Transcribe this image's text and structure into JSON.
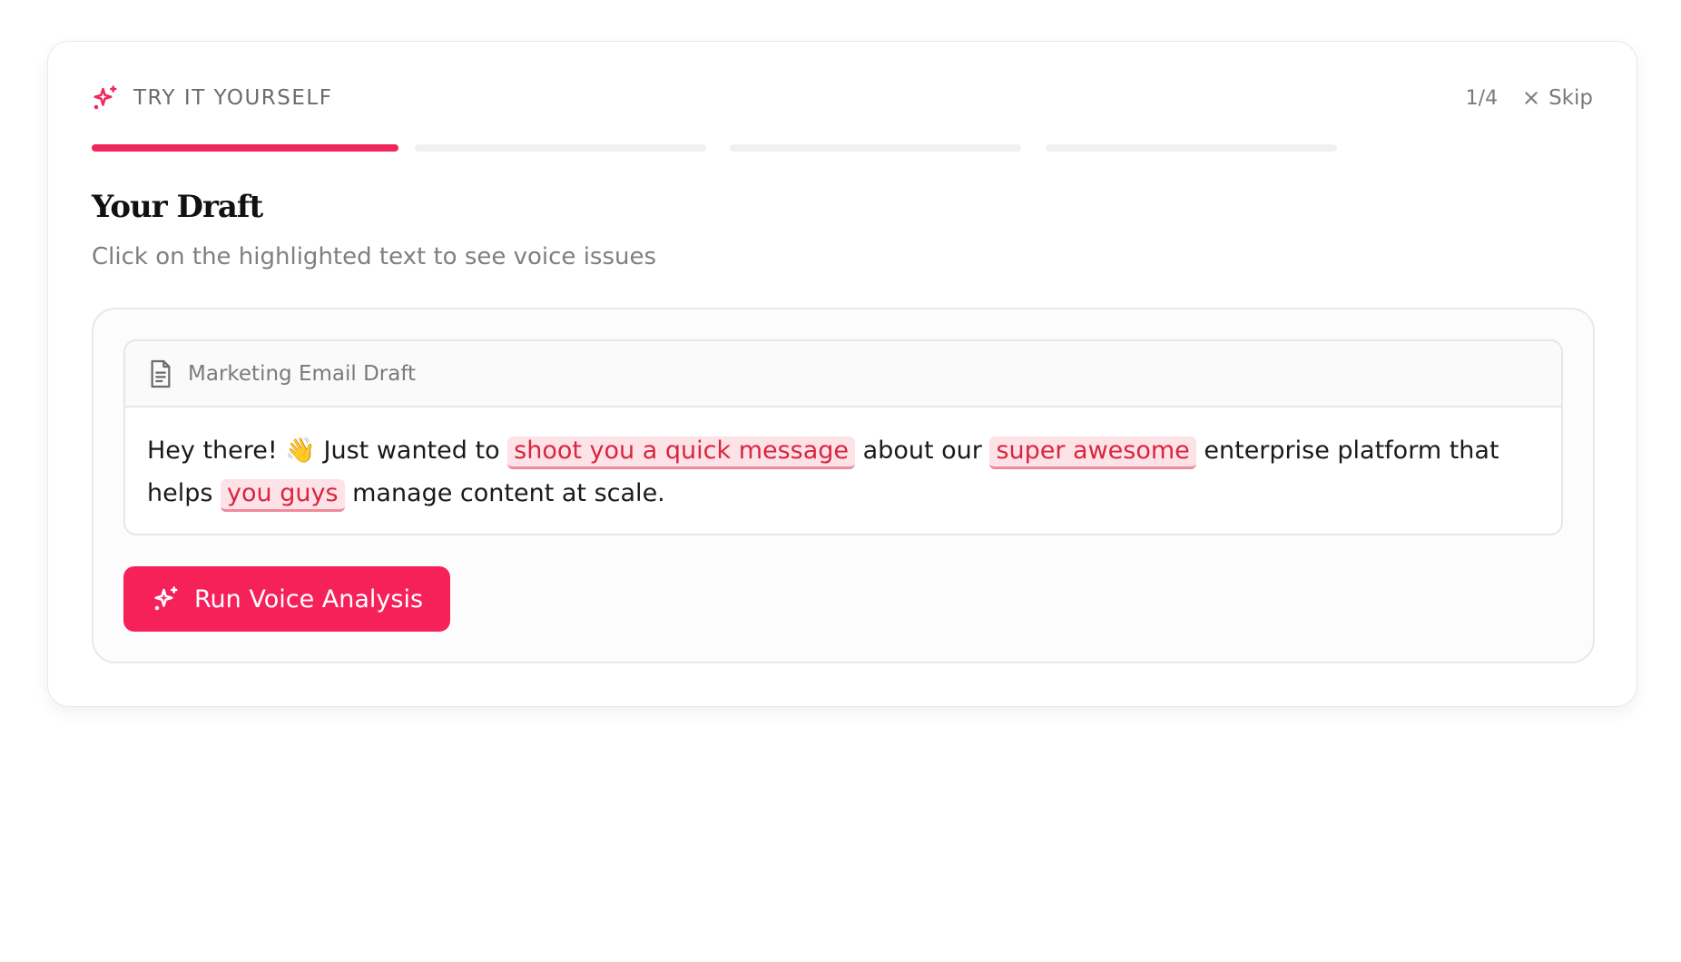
{
  "colors": {
    "accent": "#f7215a",
    "highlight_bg": "#fde3e7",
    "highlight_text": "#d9253f",
    "progress_inactive": "#f0f0f0"
  },
  "header": {
    "icon": "sparkles-icon",
    "label": "TRY IT YOURSELF",
    "step": "1/4",
    "skip_icon": "close-icon",
    "skip_label": "Skip"
  },
  "progress": {
    "current_step": 1,
    "total_steps": 4
  },
  "main": {
    "title": "Your Draft",
    "subtitle": "Click on the highlighted text to see voice issues"
  },
  "document": {
    "icon": "document-icon",
    "title": "Marketing Email Draft",
    "segments": [
      {
        "text": "Hey there! 👋 Just wanted to ",
        "highlight": false
      },
      {
        "text": "shoot you a quick message",
        "highlight": true
      },
      {
        "text": " about our ",
        "highlight": false
      },
      {
        "text": "super awesome",
        "highlight": true
      },
      {
        "text": " enterprise platform that helps ",
        "highlight": false
      },
      {
        "text": "you guys",
        "highlight": true
      },
      {
        "text": " manage content at scale.",
        "highlight": false
      }
    ]
  },
  "action": {
    "icon": "sparkles-icon",
    "label": "Run Voice Analysis"
  }
}
